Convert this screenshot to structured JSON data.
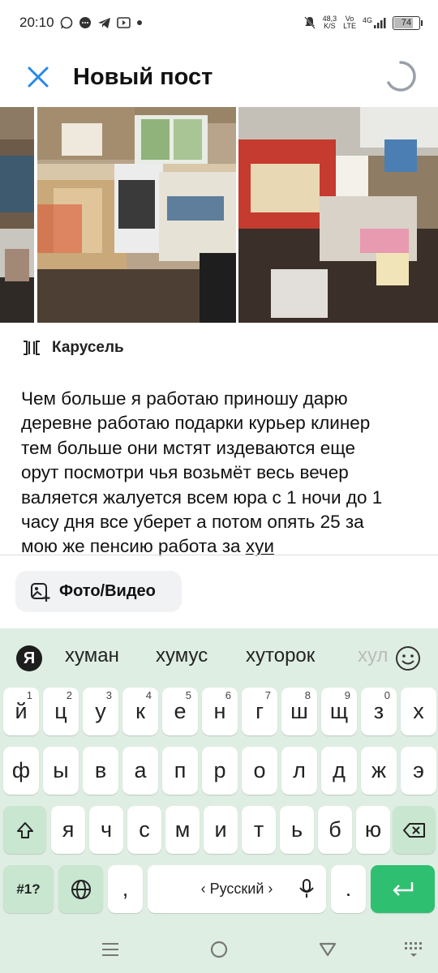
{
  "status_bar": {
    "time": "20:10",
    "notification_icons": [
      "whatsapp-icon",
      "chat-bubble-icon",
      "telegram-icon",
      "video-icon",
      "dot-icon"
    ],
    "net_speed": "48,3",
    "net_unit": "K/S",
    "volte_top": "Vo",
    "volte_bottom": "LTE",
    "network": "4G",
    "battery": "74"
  },
  "header": {
    "title": "Новый пост"
  },
  "media": {
    "photo_count_visible": 3
  },
  "carousel": {
    "label": "Карусель"
  },
  "post": {
    "lines": [
      "Чем больше я работаю приношу дарю",
      "деревне работаю подарки курьер клинер",
      "тем больше они мстят издеваются еще",
      "орут посмотри чья возьмёт весь вечер",
      "валяется жалуется всем юра с 1 ночи до 1",
      "часу дня все уберет а потом опять 25 за"
    ],
    "last_line_prefix": "мою же пенсию работа за ",
    "last_line_underlined": "хуи"
  },
  "attach": {
    "label": "Фото/Видео"
  },
  "keyboard": {
    "logo": "Я",
    "suggestions": [
      "хуман",
      "хумус",
      "хуторок",
      "хул"
    ],
    "row1": [
      {
        "k": "й",
        "h": "1"
      },
      {
        "k": "ц",
        "h": "2"
      },
      {
        "k": "у",
        "h": "3"
      },
      {
        "k": "к",
        "h": "4"
      },
      {
        "k": "е",
        "h": "5"
      },
      {
        "k": "н",
        "h": "6"
      },
      {
        "k": "г",
        "h": "7"
      },
      {
        "k": "ш",
        "h": "8"
      },
      {
        "k": "щ",
        "h": "9"
      },
      {
        "k": "з",
        "h": "0"
      },
      {
        "k": "х",
        "h": ""
      }
    ],
    "row2": [
      "ф",
      "ы",
      "в",
      "а",
      "п",
      "р",
      "о",
      "л",
      "д",
      "ж",
      "э"
    ],
    "row3": [
      "я",
      "ч",
      "с",
      "м",
      "и",
      "т",
      "ь",
      "б",
      "ю"
    ],
    "symbols_label": "#1?",
    "comma": ",",
    "space_label": "‹ Русский ›",
    "period": ".",
    "colors": {
      "background": "#dfeee3",
      "func_key": "#c8e6d0",
      "enter": "#2fbf71"
    }
  },
  "navbar": {
    "icons": [
      "menu-icon",
      "home-circle-icon",
      "back-triangle-icon",
      "keyboard-grid-icon"
    ]
  }
}
